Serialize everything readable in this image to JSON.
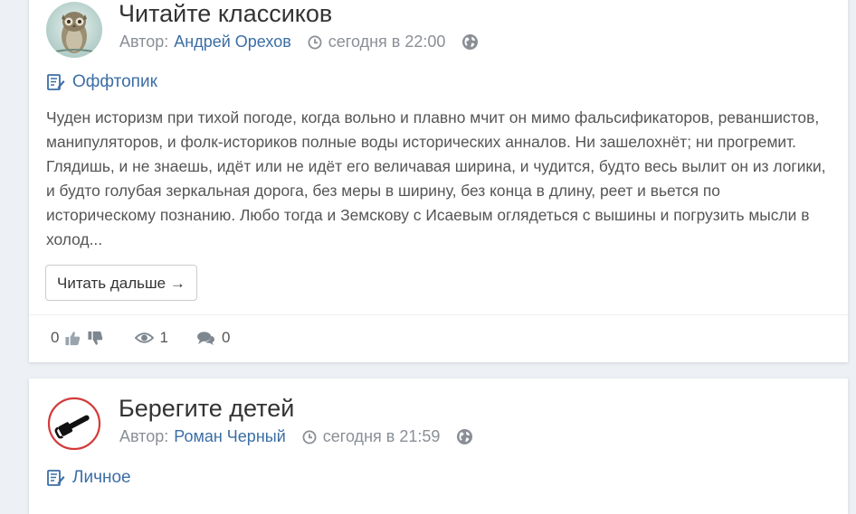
{
  "posts": [
    {
      "title": "Читайте классиков",
      "author_label": "Автор:",
      "author_name": "Андрей Орехов",
      "time": "сегодня в 22:00",
      "category": "Оффтопик",
      "excerpt": "Чуден историзм при тихой погоде, когда вольно и плавно мчит он мимо фальсификаторов, реваншистов, манипуляторов, и фолк-историков полные воды исторических анналов. Ни зашелохнёт; ни прогремит. Глядишь, и не знаешь, идёт или не идёт его величавая ширина, и чудится, будто весь вылит он из логики, и будто голубая зеркальная дорога, без меры в ширину, без конца в длину, реет и вьется по историческому познанию. Любо тогда и Земскову с Исаевым оглядеться с вышины и погрузить мысли в холод...",
      "read_more": "Читать дальше →",
      "rating": "0",
      "views": "1",
      "comments": "0"
    },
    {
      "title": "Берегите детей",
      "author_label": "Автор:",
      "author_name": "Роман Черный",
      "time": "сегодня в 21:59",
      "category": "Личное"
    }
  ],
  "icons": {
    "avatar1": "owl-avatar-icon",
    "avatar2": "no-chainsaw-avatar-icon",
    "clock": "clock-icon",
    "globe": "globe-icon",
    "category": "edit-note-icon",
    "like": "thumbs-up-icon",
    "dislike": "thumbs-down-icon",
    "views": "eye-icon",
    "comments": "comments-icon"
  },
  "colors": {
    "link": "#3b6ea5",
    "meta": "#8a8f96",
    "icon": "#7d8790",
    "background": "#edf0f5",
    "prohibition_red": "#d33b3b"
  }
}
